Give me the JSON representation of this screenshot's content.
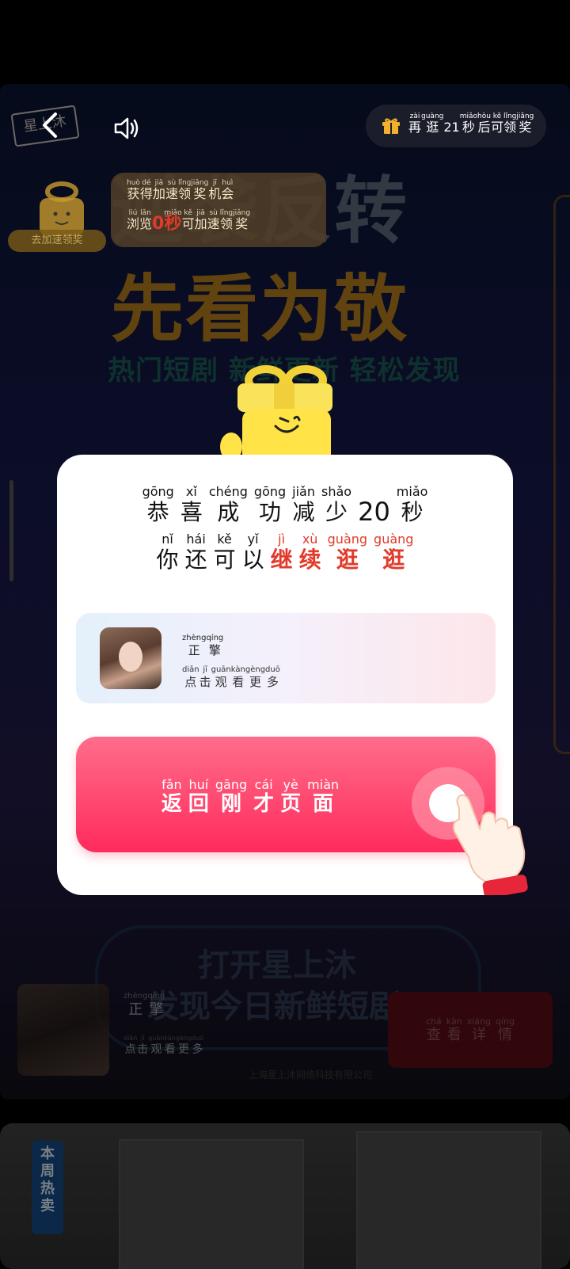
{
  "top_bar": {
    "stamp_text": "星上沐",
    "back_icon": "chevron-left-icon",
    "sound_icon": "speaker-icon",
    "gift_pill": {
      "icon": "gift-icon",
      "text": [
        {
          "py": "zài",
          "ch": "再"
        },
        {
          "py": "guàng",
          "ch": "逛"
        },
        {
          "py": "",
          "ch": "21"
        },
        {
          "py": "miǎo",
          "ch": "秒"
        },
        {
          "py": "hòu",
          "ch": "后"
        },
        {
          "py": "kě",
          "ch": "可"
        },
        {
          "py": "lǐng",
          "ch": "领"
        },
        {
          "py": "jiǎng",
          "ch": "奖"
        }
      ]
    }
  },
  "accelerate_card": {
    "line1": [
      {
        "py": "huò",
        "ch": "获"
      },
      {
        "py": "dé",
        "ch": "得"
      },
      {
        "py": "jiā",
        "ch": "加"
      },
      {
        "py": "sù",
        "ch": "速"
      },
      {
        "py": "lǐng",
        "ch": "领"
      },
      {
        "py": "jiǎng",
        "ch": "奖"
      },
      {
        "py": "jī",
        "ch": "机"
      },
      {
        "py": "huì",
        "ch": "会"
      }
    ],
    "line2": [
      {
        "py": "liú",
        "ch": "浏"
      },
      {
        "py": "lǎn",
        "ch": "览"
      },
      {
        "py": "",
        "ch": "0",
        "red": true
      },
      {
        "py": "miǎo",
        "ch": "秒",
        "red": true
      },
      {
        "py": "kě",
        "ch": "可"
      },
      {
        "py": "jiā",
        "ch": "加"
      },
      {
        "py": "sù",
        "ch": "速"
      },
      {
        "py": "lǐng",
        "ch": "领"
      },
      {
        "py": "jiǎng",
        "ch": "奖"
      }
    ],
    "mascot_label": "去加速领奖"
  },
  "background": {
    "title1": "逆袭反转",
    "title2": "先看为敬",
    "subtitle": "热门短剧 新鲜更新 轻松发现"
  },
  "dialog": {
    "line1": [
      {
        "py": "gōng",
        "ch": "恭"
      },
      {
        "py": "xǐ",
        "ch": "喜"
      },
      {
        "py": "chéng",
        "ch": "成"
      },
      {
        "py": "gōng",
        "ch": "功"
      },
      {
        "py": "jiǎn",
        "ch": "减"
      },
      {
        "py": "shǎo",
        "ch": "少"
      },
      {
        "num": "20"
      },
      {
        "py": "miǎo",
        "ch": "秒"
      }
    ],
    "line2": [
      {
        "py": "nǐ",
        "ch": "你"
      },
      {
        "py": "hái",
        "ch": "还"
      },
      {
        "py": "kě",
        "ch": "可"
      },
      {
        "py": "yǐ",
        "ch": "以"
      },
      {
        "py": "jì",
        "ch": "继",
        "red": true
      },
      {
        "py": "xù",
        "ch": "续",
        "red": true
      },
      {
        "py": "guàng",
        "ch": "逛",
        "red": true
      },
      {
        "py": "guàng",
        "ch": "逛",
        "red": true
      }
    ],
    "profile": {
      "name": [
        {
          "py": "zhèng",
          "ch": "正"
        },
        {
          "py": "qíng",
          "ch": "擎"
        }
      ],
      "sub": [
        {
          "py": "diǎn",
          "ch": "点"
        },
        {
          "py": "jī",
          "ch": "击"
        },
        {
          "py": "guān",
          "ch": "观"
        },
        {
          "py": "kàn",
          "ch": "看"
        },
        {
          "py": "gèng",
          "ch": "更"
        },
        {
          "py": "duō",
          "ch": "多"
        }
      ]
    },
    "return_button": [
      {
        "py": "fǎn",
        "ch": "返"
      },
      {
        "py": "huí",
        "ch": "回"
      },
      {
        "py": "gāng",
        "ch": "刚"
      },
      {
        "py": "cái",
        "ch": "才"
      },
      {
        "py": "yè",
        "ch": "页"
      },
      {
        "py": "miàn",
        "ch": "面"
      }
    ]
  },
  "bottom_ad": {
    "cta_line1": "打开星上沐",
    "cta_line2": "发现今日新鲜短剧",
    "name": [
      {
        "py": "zhèng",
        "ch": "正"
      },
      {
        "py": "qíng",
        "ch": "擎"
      }
    ],
    "sub": [
      {
        "py": "diǎn",
        "ch": "点"
      },
      {
        "py": "jī",
        "ch": "击"
      },
      {
        "py": "guān",
        "ch": "观"
      },
      {
        "py": "kàn",
        "ch": "看"
      },
      {
        "py": "gèng",
        "ch": "更"
      },
      {
        "py": "duō",
        "ch": "多"
      }
    ],
    "detail_button": [
      {
        "py": "chá",
        "ch": "查"
      },
      {
        "py": "kàn",
        "ch": "看"
      },
      {
        "py": "xiáng",
        "ch": "详"
      },
      {
        "py": "qíng",
        "ch": "情"
      }
    ],
    "footnote": "上海星上沐网络科技有限公司"
  },
  "next_card": {
    "tag": [
      "本",
      "周",
      "热",
      "卖"
    ]
  },
  "colors": {
    "accent_red": "#e23a2a",
    "button_pink": "#ff2b5b",
    "dialog_bg": "#ffffff"
  }
}
